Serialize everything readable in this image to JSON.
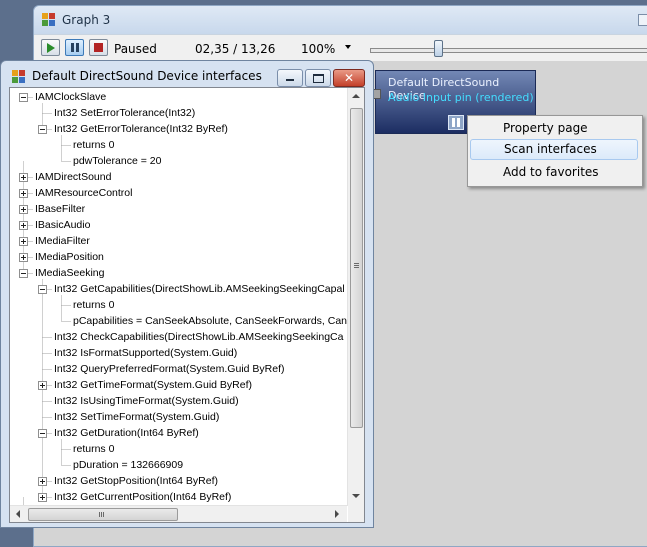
{
  "main_window": {
    "title": "Graph 3",
    "toolbar": {
      "state": "Paused",
      "position": "02,35 / 13,26",
      "zoom": "100%",
      "seek_fraction": 0.22
    }
  },
  "filter": {
    "name": "Default DirectSound Device",
    "pin": "Audio Input pin (rendered)"
  },
  "context_menu": {
    "items": [
      "Property page",
      "Scan interfaces",
      "Add to favorites"
    ],
    "highlighted": "Scan interfaces"
  },
  "dialog": {
    "title": "Default DirectSound Device interfaces",
    "tree": [
      {
        "text": "IAMClockSlave",
        "level": 0,
        "exp": "-"
      },
      {
        "text": "Int32 SetErrorTolerance(Int32)",
        "level": 1,
        "exp": ""
      },
      {
        "text": "Int32 GetErrorTolerance(Int32 ByRef)",
        "level": 1,
        "exp": "-"
      },
      {
        "text": "returns 0",
        "level": 2,
        "exp": ""
      },
      {
        "text": "pdwTolerance = 20",
        "level": 2,
        "exp": ""
      },
      {
        "text": "IAMDirectSound",
        "level": 0,
        "exp": "+"
      },
      {
        "text": "IAMResourceControl",
        "level": 0,
        "exp": "+"
      },
      {
        "text": "IBaseFilter",
        "level": 0,
        "exp": "+"
      },
      {
        "text": "IBasicAudio",
        "level": 0,
        "exp": "+"
      },
      {
        "text": "IMediaFilter",
        "level": 0,
        "exp": "+"
      },
      {
        "text": "IMediaPosition",
        "level": 0,
        "exp": "+"
      },
      {
        "text": "IMediaSeeking",
        "level": 0,
        "exp": "-"
      },
      {
        "text": "Int32 GetCapabilities(DirectShowLib.AMSeekingSeekingCapal",
        "level": 1,
        "exp": "-"
      },
      {
        "text": "returns 0",
        "level": 2,
        "exp": ""
      },
      {
        "text": "pCapabilities = CanSeekAbsolute, CanSeekForwards, Can",
        "level": 2,
        "exp": ""
      },
      {
        "text": "Int32 CheckCapabilities(DirectShowLib.AMSeekingSeekingCa",
        "level": 1,
        "exp": ""
      },
      {
        "text": "Int32 IsFormatSupported(System.Guid)",
        "level": 1,
        "exp": ""
      },
      {
        "text": "Int32 QueryPreferredFormat(System.Guid ByRef)",
        "level": 1,
        "exp": ""
      },
      {
        "text": "Int32 GetTimeFormat(System.Guid ByRef)",
        "level": 1,
        "exp": "+"
      },
      {
        "text": "Int32 IsUsingTimeFormat(System.Guid)",
        "level": 1,
        "exp": ""
      },
      {
        "text": "Int32 SetTimeFormat(System.Guid)",
        "level": 1,
        "exp": ""
      },
      {
        "text": "Int32 GetDuration(Int64 ByRef)",
        "level": 1,
        "exp": "-"
      },
      {
        "text": "returns 0",
        "level": 2,
        "exp": ""
      },
      {
        "text": "pDuration = 132666909",
        "level": 2,
        "exp": ""
      },
      {
        "text": "Int32 GetStopPosition(Int64 ByRef)",
        "level": 1,
        "exp": "+"
      },
      {
        "text": "Int32 GetCurrentPosition(Int64 ByRef)",
        "level": 1,
        "exp": "+"
      }
    ]
  }
}
